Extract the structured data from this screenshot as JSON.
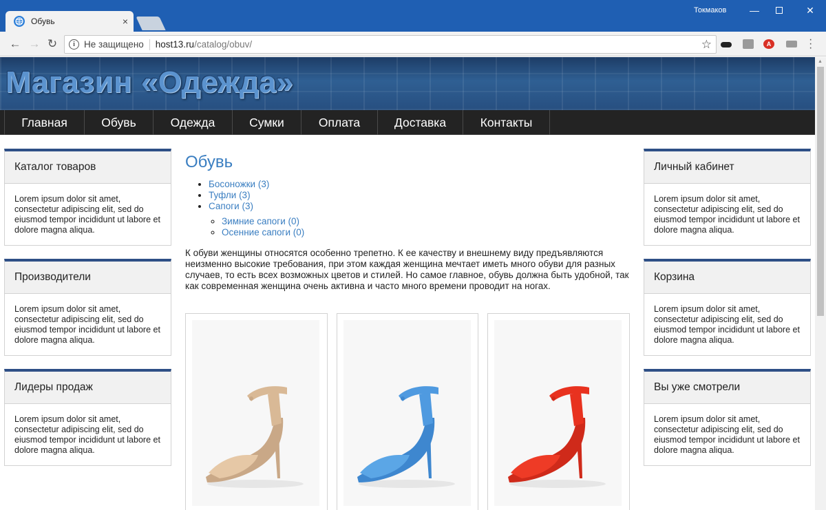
{
  "browser": {
    "tab_title": "Обувь",
    "tab_close": "×",
    "user": "Токмаков",
    "security_label": "Не защищено",
    "url_host": "host13.ru",
    "url_path": "/catalog/obuv/"
  },
  "site": {
    "logo": "Магазин «Одежда»",
    "nav": [
      "Главная",
      "Обувь",
      "Одежда",
      "Сумки",
      "Оплата",
      "Доставка",
      "Контакты"
    ]
  },
  "left_blocks": [
    {
      "title": "Каталог товаров",
      "text": "Lorem ipsum dolor sit amet, consectetur adipiscing elit, sed do eiusmod tempor incididunt ut labore et dolore magna aliqua."
    },
    {
      "title": "Производители",
      "text": "Lorem ipsum dolor sit amet, consectetur adipiscing elit, sed do eiusmod tempor incididunt ut labore et dolore magna aliqua."
    },
    {
      "title": "Лидеры продаж",
      "text": "Lorem ipsum dolor sit amet, consectetur adipiscing elit, sed do eiusmod tempor incididunt ut labore et dolore magna aliqua."
    }
  ],
  "right_blocks": [
    {
      "title": "Личный кабинет",
      "text": "Lorem ipsum dolor sit amet, consectetur adipiscing elit, sed do eiusmod tempor incididunt ut labore et dolore magna aliqua."
    },
    {
      "title": "Корзина",
      "text": "Lorem ipsum dolor sit amet, consectetur adipiscing elit, sed do eiusmod tempor incididunt ut labore et dolore magna aliqua."
    },
    {
      "title": "Вы уже смотрели",
      "text": "Lorem ipsum dolor sit amet, consectetur adipiscing elit, sed do eiusmod tempor incididunt ut labore et dolore magna aliqua."
    }
  ],
  "content": {
    "title": "Обувь",
    "categories": [
      "Босоножки (3)",
      "Туфли (3)",
      "Сапоги (3)"
    ],
    "subcategories": [
      "Зимние сапоги (0)",
      "Осенние сапоги (0)"
    ],
    "description": "К обуви женщины относятся особенно трепетно. К ее качеству и внешнему виду предъявляются неизменно высокие требования, при этом каждая женщина мечтает иметь много обуви для разных случаев, то есть всех возможных цветов и стилей. Но самое главное, обувь должна быть удобной, так как современная женщина очень активна и часто много времени проводит на ногах.",
    "products": [
      {
        "color": "#e6c8a6",
        "strap": "#d9b996",
        "sole": "#c9a887"
      },
      {
        "color": "#5ba6e6",
        "strap": "#4f9ae0",
        "sole": "#3e87cf"
      },
      {
        "color": "#ee3b26",
        "strap": "#e8321f",
        "sole": "#cf2a1a"
      }
    ]
  },
  "colors": {
    "titlebar": "#1f5fb3",
    "link": "#3a7ec1",
    "nav_bg": "#232323",
    "block_accent": "#2e4f86"
  }
}
